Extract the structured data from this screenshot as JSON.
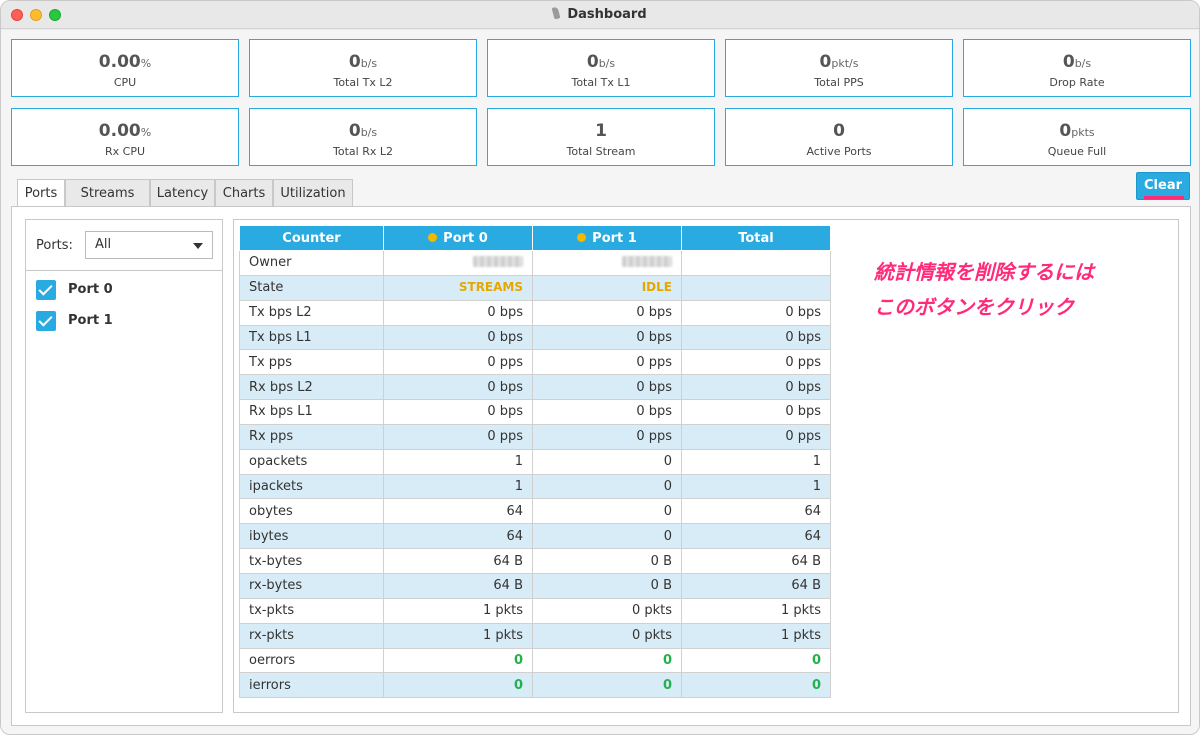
{
  "window": {
    "title": "Dashboard"
  },
  "stats": [
    {
      "value": "0.00",
      "unit": "%",
      "label": "CPU"
    },
    {
      "value": "0",
      "unit": "b/s",
      "label": "Total Tx L2"
    },
    {
      "value": "0",
      "unit": "b/s",
      "label": "Total Tx L1"
    },
    {
      "value": "0",
      "unit": "pkt/s",
      "label": "Total PPS"
    },
    {
      "value": "0",
      "unit": "b/s",
      "label": "Drop Rate"
    },
    {
      "value": "0.00",
      "unit": "%",
      "label": "Rx CPU"
    },
    {
      "value": "0",
      "unit": "b/s",
      "label": "Total Rx L2"
    },
    {
      "value": "1",
      "unit": "",
      "label": "Total Stream"
    },
    {
      "value": "0",
      "unit": "",
      "label": "Active Ports"
    },
    {
      "value": "0",
      "unit": "pkts",
      "label": "Queue Full"
    }
  ],
  "tabs": [
    {
      "label": "Ports",
      "active": true
    },
    {
      "label": "Streams",
      "active": false
    },
    {
      "label": "Latency",
      "active": false
    },
    {
      "label": "Charts",
      "active": false
    },
    {
      "label": "Utilization",
      "active": false
    }
  ],
  "clear_button": {
    "label": "Clear"
  },
  "ports_filter": {
    "label": "Ports:",
    "selected": "All"
  },
  "port_checks": [
    {
      "label": "Port 0",
      "checked": true
    },
    {
      "label": "Port 1",
      "checked": true
    }
  ],
  "table": {
    "headers": [
      "Counter",
      "Port 0",
      "Port 1",
      "Total"
    ],
    "header_dot_color": "#f5b800",
    "rows": [
      {
        "name": "Owner",
        "p0": "",
        "p1": "",
        "total": "",
        "kind": "owner"
      },
      {
        "name": "State",
        "p0": "STREAMS",
        "p1": "IDLE",
        "total": "",
        "kind": "state"
      },
      {
        "name": "Tx bps L2",
        "p0": "0 bps",
        "p1": "0 bps",
        "total": "0 bps"
      },
      {
        "name": "Tx bps L1",
        "p0": "0 bps",
        "p1": "0 bps",
        "total": "0 bps"
      },
      {
        "name": "Tx pps",
        "p0": "0 pps",
        "p1": "0 pps",
        "total": "0 pps"
      },
      {
        "name": "Rx bps L2",
        "p0": "0 bps",
        "p1": "0 bps",
        "total": "0 bps"
      },
      {
        "name": "Rx bps L1",
        "p0": "0 bps",
        "p1": "0 bps",
        "total": "0 bps"
      },
      {
        "name": "Rx pps",
        "p0": "0 pps",
        "p1": "0 pps",
        "total": "0 pps"
      },
      {
        "name": "opackets",
        "p0": "1",
        "p1": "0",
        "total": "1"
      },
      {
        "name": "ipackets",
        "p0": "1",
        "p1": "0",
        "total": "1"
      },
      {
        "name": "obytes",
        "p0": "64",
        "p1": "0",
        "total": "64"
      },
      {
        "name": "ibytes",
        "p0": "64",
        "p1": "0",
        "total": "64"
      },
      {
        "name": "tx-bytes",
        "p0": "64 B",
        "p1": "0 B",
        "total": "64 B"
      },
      {
        "name": "rx-bytes",
        "p0": "64 B",
        "p1": "0 B",
        "total": "64 B"
      },
      {
        "name": "tx-pkts",
        "p0": "1 pkts",
        "p1": "0 pkts",
        "total": "1 pkts"
      },
      {
        "name": "rx-pkts",
        "p0": "1 pkts",
        "p1": "0 pkts",
        "total": "1 pkts"
      },
      {
        "name": "oerrors",
        "p0": "0",
        "p1": "0",
        "total": "0",
        "kind": "error"
      },
      {
        "name": "ierrors",
        "p0": "0",
        "p1": "0",
        "total": "0",
        "kind": "error"
      }
    ]
  },
  "annotation": {
    "line1": "統計情報を削除するには",
    "line2": "このボタンをクリック",
    "color": "#ff2b7a"
  },
  "colors": {
    "accent": "#29abe2",
    "row_alt": "#d8ecf7",
    "state": "#e6a700",
    "ok": "#22b14c"
  }
}
